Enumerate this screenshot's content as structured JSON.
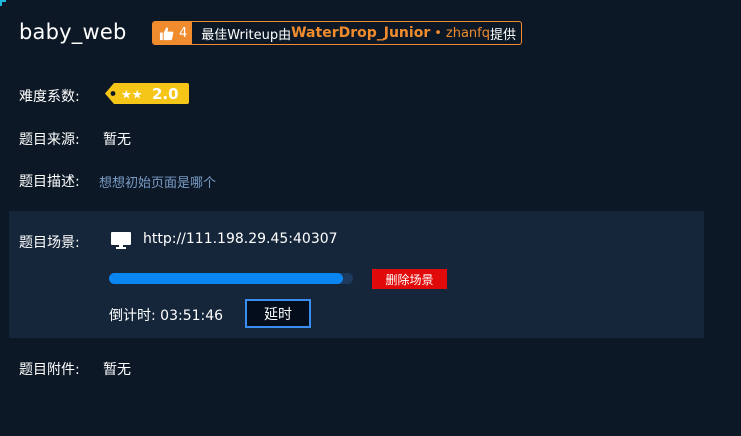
{
  "challenge": {
    "title": "baby_web"
  },
  "writeup_badge": {
    "likes": "4",
    "prefix": "最佳Writeup由",
    "author": "WaterDrop_Junior",
    "separator": "•",
    "user": "zhanfq",
    "suffix": "提供",
    "accent_color": "#f08c2e"
  },
  "difficulty": {
    "label": "难度系数:",
    "stars": "★★",
    "value": "2.0",
    "tag_color": "#f5c518"
  },
  "source": {
    "label": "题目来源:",
    "value": "暂无"
  },
  "description": {
    "label": "题目描述:",
    "value": "想想初始页面是哪个"
  },
  "scene": {
    "label": "题目场景:",
    "icon": "monitor-icon",
    "url": "http://111.198.29.45:40307",
    "progress_fraction": 0.96,
    "delete_label": "删除场景",
    "countdown_label": "倒计时:",
    "countdown_value": "03:51:46",
    "extend_label": "延时"
  },
  "attachment": {
    "label": "题目附件:",
    "value": "暂无"
  }
}
